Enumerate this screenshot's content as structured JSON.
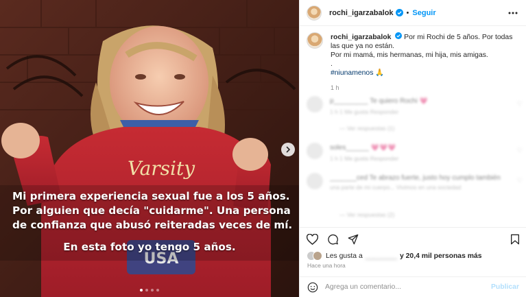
{
  "post": {
    "photo_caption_lines": [
      "Mi primera experiencia sexual fue a los 5 años.",
      "Por alguien que decía \"cuidarme\". Una persona",
      "de confianza que abusó reiteradas veces de mí."
    ],
    "photo_caption_last": "En esta foto yo tengo 5 años.",
    "sweater_text": "Varsity",
    "sweater_badge": "USA",
    "carousel": {
      "total": 4,
      "active": 1
    }
  },
  "header": {
    "username": "rochi_igarzabalok",
    "separator": "•",
    "follow_label": "Seguir"
  },
  "caption": {
    "username": "rochi_igarzabalok",
    "text_1": "Por mi Rochi de 5 años. Por todas las que ya no están.",
    "text_2": "Por mi mamá, mis hermanas, mi hija, mis amigas.",
    "text_3": ".",
    "hashtag": "#niunamenos",
    "hashtag_emoji": "🙏",
    "time": "1 h"
  },
  "comments": [
    {
      "text": "p_________ Te quiero Rochi 💗",
      "meta": "1 h   1 Me gusta   Responder",
      "sub": "— Ver respuestas (1)"
    },
    {
      "text": "soles______ 💗💗💗",
      "meta": "1 h   1 Me gusta   Responder",
      "sub": ""
    },
    {
      "text": "_______ced Te abrazo fuerte, justo hoy cumplo también",
      "meta": "una parte de mi cuerpo... Vivimos en una sociedad",
      "sub": "— Ver respuestas (2)"
    }
  ],
  "likes": {
    "prefix": "Les gusta a",
    "blurred_user": "________",
    "suffix_bold": "y 20,4 mil personas más"
  },
  "posted_time": "Hace una hora",
  "comment_input": {
    "placeholder": "Agrega un comentario...",
    "publish_label": "Publicar"
  },
  "colors": {
    "accent": "#0095f6",
    "publish_disabled": "#b2dffc",
    "sweater_red": "#b8232c"
  }
}
